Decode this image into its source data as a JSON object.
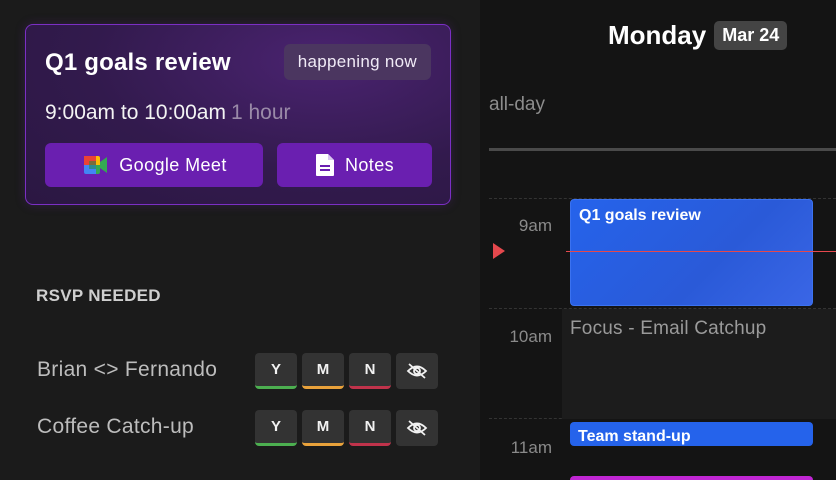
{
  "current_event": {
    "title": "Q1 goals review",
    "status_badge": "happening now",
    "time_range": "9:00am to 10:00am",
    "duration": "1 hour",
    "meet_button_label": "Google Meet",
    "notes_button_label": "Notes"
  },
  "rsvp": {
    "header": "RSVP NEEDED",
    "items": [
      {
        "name": "Brian <> Fernando",
        "yes": "Y",
        "maybe": "M",
        "no": "N"
      },
      {
        "name": "Coffee Catch-up",
        "yes": "Y",
        "maybe": "M",
        "no": "N"
      }
    ]
  },
  "calendar": {
    "day_name": "Monday",
    "date": "Mar 24",
    "allday_label": "all-day",
    "hours": [
      "9am",
      "10am",
      "11am"
    ],
    "events": [
      {
        "title": "Q1 goals review",
        "color": "#2563eb"
      },
      {
        "title": "Focus - Email Catchup",
        "color": "#1c1c1c"
      },
      {
        "title": "Team stand-up",
        "color": "#2563eb"
      },
      {
        "title": "",
        "color": "#c026d3"
      }
    ]
  },
  "colors": {
    "accent_purple": "#6a1fb0",
    "card_border": "#7b2fc4",
    "event_blue": "#2563eb",
    "now_line_red": "#e5484d",
    "rsvp_yes": "#4caf50",
    "rsvp_maybe": "#e9a23b",
    "rsvp_no": "#c0334b"
  },
  "icons": {
    "meet": "google-meet-icon",
    "notes": "notes-document-icon",
    "hide": "eye-off-icon",
    "now": "current-time-marker"
  }
}
